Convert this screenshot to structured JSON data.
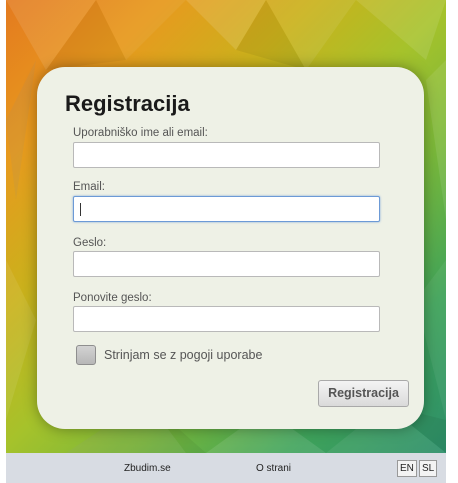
{
  "form": {
    "title": "Registracija",
    "fields": [
      {
        "label": "Uporabniško ime ali email:",
        "value": "",
        "focused": false
      },
      {
        "label": "Email:",
        "value": "",
        "focused": true
      },
      {
        "label": "Geslo:",
        "value": "",
        "focused": false
      },
      {
        "label": "Ponovite geslo:",
        "value": "",
        "focused": false
      }
    ],
    "terms_label": "Strinjam se z pogoji uporabe",
    "terms_checked": false,
    "submit_label": "Registracija"
  },
  "footer": {
    "home_link": "Zbudim.se",
    "about_link": "O strani",
    "languages": [
      "EN",
      "SL"
    ]
  },
  "colors": {
    "card_bg": "#eef1e6",
    "footer_bg": "#d8dce3",
    "focus_border": "#6c9ad6"
  }
}
